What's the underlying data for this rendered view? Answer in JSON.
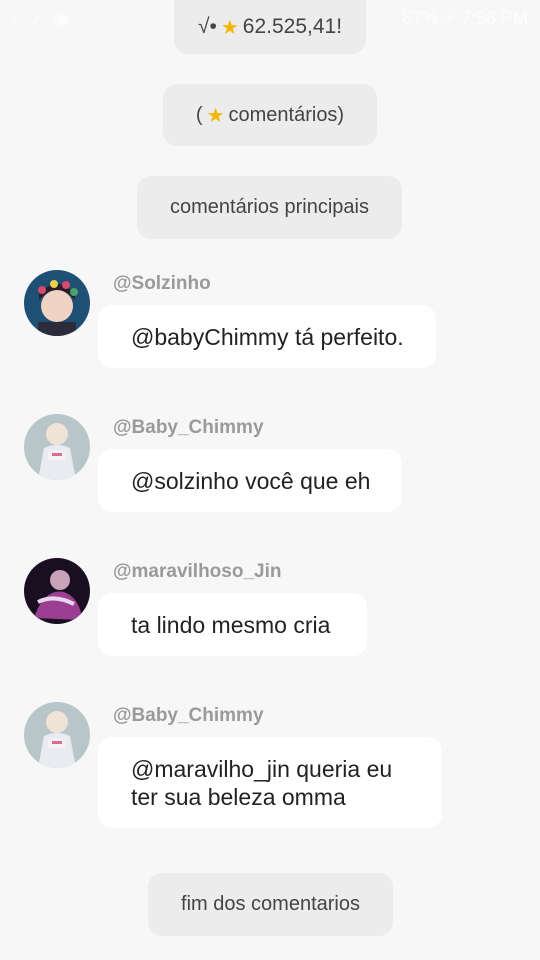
{
  "status_bar": {
    "left_icons": "↓ ♪ ◉ …",
    "battery": "87%",
    "time": "7:56 PM"
  },
  "top_pill": {
    "text_before": "√•",
    "text_after": "62.525,41!"
  },
  "stars_pill": {
    "open": "(",
    "label": "comentários)"
  },
  "principal_pill": {
    "label": "comentários principais"
  },
  "comments": [
    {
      "username": "@Solzinho",
      "text": "@babyChimmy tá perfeito."
    },
    {
      "username": "@Baby_Chimmy",
      "text": "@solzinho você que eh"
    },
    {
      "username": "@maravilhoso_Jin",
      "text": "ta lindo mesmo cria"
    },
    {
      "username": "@Baby_Chimmy",
      "text_line1": "@maravilho_jin queria eu",
      "text_line2": "ter sua beleza omma"
    }
  ],
  "end_pill": {
    "label": "fim dos comentarios"
  },
  "colors": {
    "background": "#f7f7f7",
    "pill": "#ececec",
    "bubble": "#ffffff",
    "username": "#9a9a9a",
    "star": "#f2b705"
  }
}
